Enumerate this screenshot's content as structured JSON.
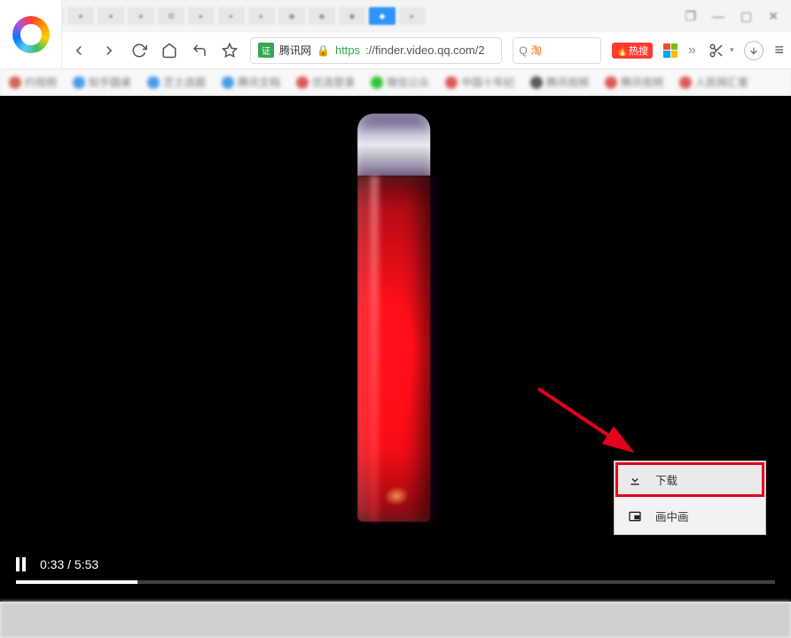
{
  "window": {
    "minimize": "—",
    "maximize": "▢",
    "close": "✕",
    "restore_more": "❐"
  },
  "addressbar": {
    "cert_label": "证",
    "site_name": "腾讯网",
    "lock": "🔒",
    "url_protocol": "https",
    "url_rest": "://finder.video.qq.com/2"
  },
  "searchbox": {
    "mag": "Q",
    "tao_label": "淘",
    "hot_label": "热搜"
  },
  "toolbar": {
    "more_label": "»",
    "menu": "≡"
  },
  "bookmarks": [
    {
      "label": "约视频",
      "color": "#c43"
    },
    {
      "label": "知乎圆桌",
      "color": "#1e88e5"
    },
    {
      "label": "芝士选题",
      "color": "#1e88e5"
    },
    {
      "label": "腾讯文档",
      "color": "#1e88e5"
    },
    {
      "label": "优选登录",
      "color": "#d33"
    },
    {
      "label": "微信公众",
      "color": "#0b0"
    },
    {
      "label": "中国十年纪",
      "color": "#d33"
    },
    {
      "label": "腾讯视频",
      "color": "#333"
    },
    {
      "label": "腾讯视频",
      "color": "#d33"
    },
    {
      "label": "人民网汇客",
      "color": "#d33"
    }
  ],
  "player": {
    "current_time": "0:33",
    "divider": "/",
    "total_time": "5:53",
    "progress_percent": 16
  },
  "context_menu": {
    "download": "下载",
    "pip": "画中画"
  }
}
